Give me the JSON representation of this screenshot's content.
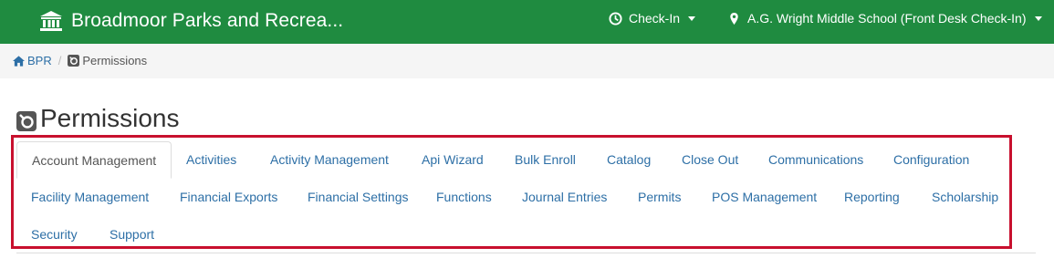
{
  "header": {
    "brand_icon": "bank-building-icon",
    "title": "Broadmoor Parks and Recrea...",
    "checkin": {
      "icon": "clock-icon",
      "label": "Check-In"
    },
    "location": {
      "icon": "map-pin-icon",
      "label": "A.G. Wright Middle School (Front Desk Check-In)"
    },
    "bg_color": "#1f8b40"
  },
  "breadcrumb": {
    "home": {
      "icon": "home-icon",
      "label": "BPR"
    },
    "separator": "/",
    "current": {
      "icon": "permissions-icon",
      "label": "Permissions"
    }
  },
  "page": {
    "title": "Permissions",
    "title_icon": "permissions-icon"
  },
  "tabs": [
    {
      "label": "Account Management",
      "active": true
    },
    {
      "label": "Activities"
    },
    {
      "label": "Activity Management"
    },
    {
      "label": "Api Wizard"
    },
    {
      "label": "Bulk Enroll"
    },
    {
      "label": "Catalog"
    },
    {
      "label": "Close Out"
    },
    {
      "label": "Communications"
    },
    {
      "label": "Configuration"
    },
    {
      "label": "Facility Management"
    },
    {
      "label": "Financial Exports"
    },
    {
      "label": "Financial Settings"
    },
    {
      "label": "Functions"
    },
    {
      "label": "Journal Entries"
    },
    {
      "label": "Permits"
    },
    {
      "label": "POS Management"
    },
    {
      "label": "Reporting"
    },
    {
      "label": "Scholarship"
    },
    {
      "label": "Security"
    },
    {
      "label": "Support"
    }
  ],
  "highlight_color": "#c8102e",
  "link_color": "#2d6fa6"
}
